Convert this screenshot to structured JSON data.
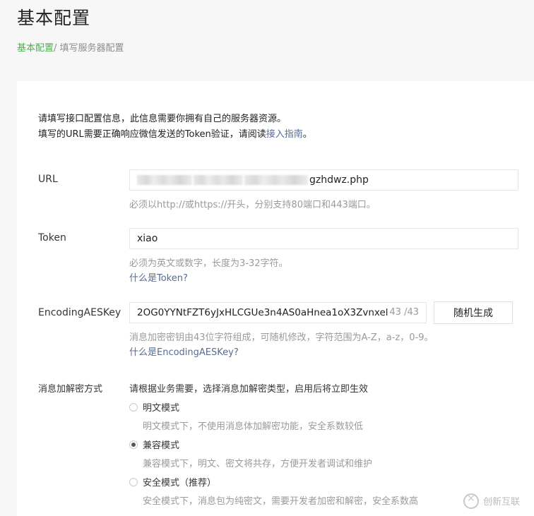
{
  "header": {
    "title": "基本配置",
    "breadcrumb_home": "基本配置",
    "breadcrumb_sep": "/ ",
    "breadcrumb_current": "填写服务器配置"
  },
  "intro": {
    "line1": "请填写接口配置信息，此信息需要你拥有自己的服务器资源。",
    "line2_prefix": "填写的URL需要正确响应微信发送的Token验证，请阅读",
    "line2_link": "接入指南",
    "line2_suffix": "。"
  },
  "url_field": {
    "label": "URL",
    "value_visible": "gzhdwz.php",
    "tip": "必须以http://或https://开头，分别支持80端口和443端口。"
  },
  "token_field": {
    "label": "Token",
    "value": "xiao",
    "tip": "必须为英文或数字，长度为3-32字符。",
    "help_link": "什么是Token?"
  },
  "aes_field": {
    "label": "EncodingAESKey",
    "value": "2OG0YYNtFZT6yJxHLCGUe3n4AS0aHnea1oX3Zvnxel",
    "counter": "43 /43",
    "random_button": "随机生成",
    "tip": "消息加密密钥由43位字符组成，可随机修改，字符范围为A-Z，a-z，0-9。",
    "help_link": "什么是EncodingAESKey?"
  },
  "encryption": {
    "label": "消息加解密方式",
    "tip": "请根据业务需要，选择消息加解密类型，启用后将立即生效",
    "options": [
      {
        "label": "明文模式",
        "desc": "明文模式下，不使用消息体加解密功能，安全系数较低",
        "checked": false
      },
      {
        "label": "兼容模式",
        "desc": "兼容模式下，明文、密文将共存，方便开发者调试和维护",
        "checked": true
      },
      {
        "label": "安全模式（推荐）",
        "desc": "安全模式下，消息包为纯密文，需要开发者加密和解密，安全系数高",
        "checked": false
      }
    ]
  },
  "watermark": {
    "text": "创新互联"
  }
}
